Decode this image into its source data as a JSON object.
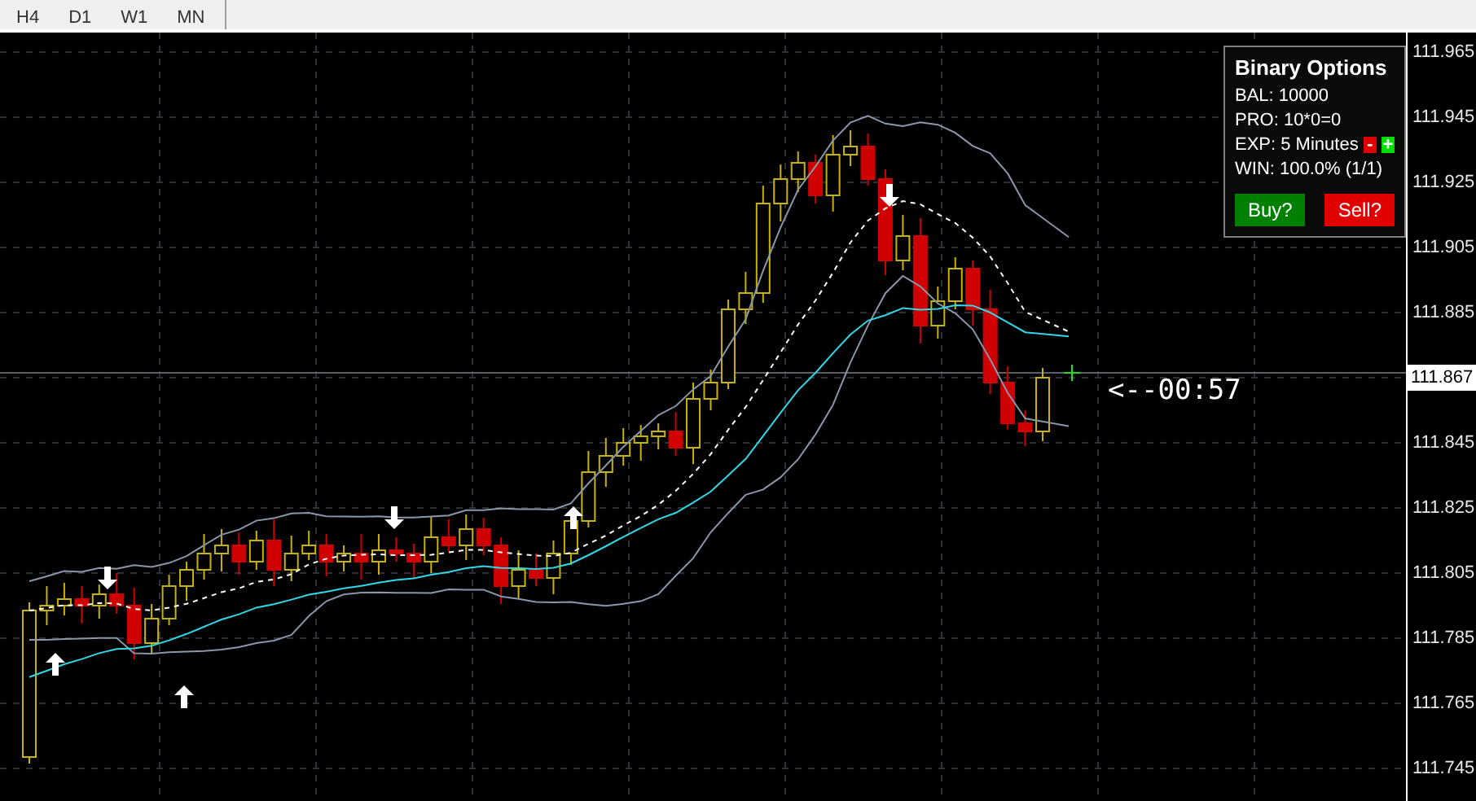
{
  "timeframe_tabs": [
    {
      "label": "H4"
    },
    {
      "label": "D1"
    },
    {
      "label": "W1"
    },
    {
      "label": "MN"
    }
  ],
  "chart": {
    "price_axis": [
      {
        "label": "111.965",
        "current": false
      },
      {
        "label": "111.945",
        "current": false
      },
      {
        "label": "111.925",
        "current": false
      },
      {
        "label": "111.905",
        "current": false
      },
      {
        "label": "111.885",
        "current": false
      },
      {
        "label": "111.867",
        "current": true
      },
      {
        "label": "111.845",
        "current": false
      },
      {
        "label": "111.825",
        "current": false
      },
      {
        "label": "111.805",
        "current": false
      },
      {
        "label": "111.785",
        "current": false
      },
      {
        "label": "111.765",
        "current": false
      },
      {
        "label": "111.745",
        "current": false
      }
    ],
    "countdown": "<--00:57"
  },
  "binary_options_panel": {
    "title": "Binary Options",
    "balance": "BAL: 10000",
    "profit": "PRO: 10*0=0",
    "expiry": "EXP: 5 Minutes",
    "decrease_button": "-",
    "increase_button": "+",
    "win_rate": "WIN: 100.0% (1/1)",
    "buttons": [
      {
        "label": "Buy?",
        "kind": "buy"
      },
      {
        "label": "Sell?",
        "kind": "sell"
      }
    ]
  }
}
